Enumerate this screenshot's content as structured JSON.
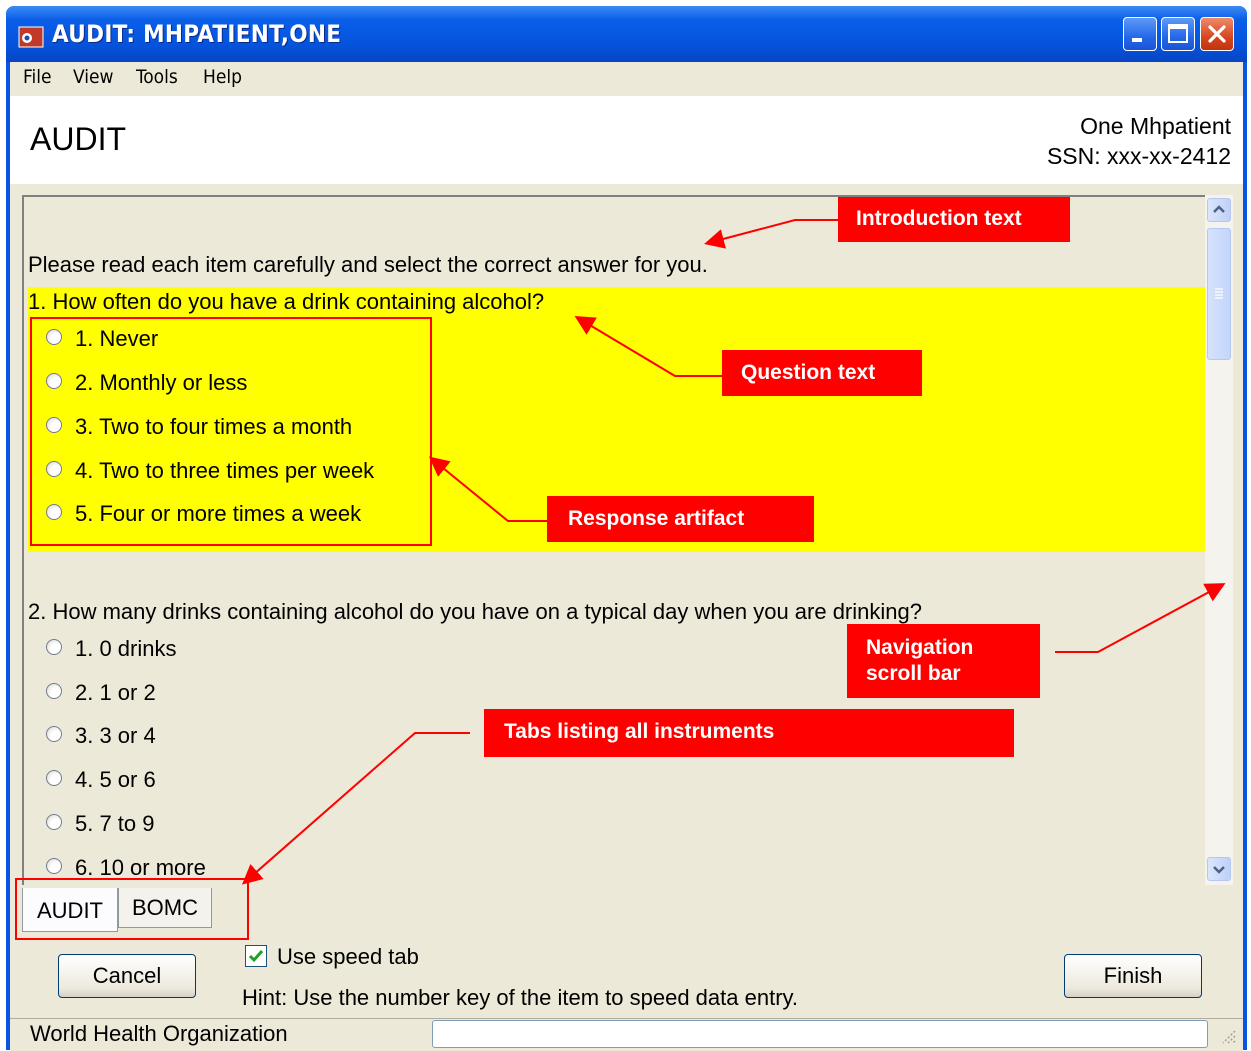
{
  "window": {
    "title": "AUDIT: MHPATIENT,ONE"
  },
  "menu": [
    "File",
    "View",
    "Tools",
    "Help"
  ],
  "header": {
    "instrument": "AUDIT",
    "patient_name": "One Mhpatient",
    "ssn": "SSN: xxx-xx-2412"
  },
  "content": {
    "intro": "Please read each item carefully and select the correct answer for you.",
    "questions": [
      {
        "text": "1. How often do you have a drink containing alcohol?",
        "options": [
          "1. Never",
          "2. Monthly or less",
          "3. Two to four times a month",
          "4. Two to three times per week",
          "5. Four or more times a week"
        ]
      },
      {
        "text": "2. How many drinks containing alcohol do you have on a typical day when you are drinking?",
        "options": [
          "1. 0 drinks",
          "2. 1 or 2",
          "3. 3 or 4",
          "4. 5 or 6",
          "5. 7 to 9",
          "6. 10 or more"
        ]
      }
    ]
  },
  "annotations": {
    "intro": "Introduction text",
    "question": "Question text",
    "response": "Response artifact",
    "scroll_line1": "Navigation",
    "scroll_line2": "scroll bar",
    "tabs": "Tabs listing all instruments"
  },
  "tabs": [
    "AUDIT",
    "BOMC"
  ],
  "footer": {
    "cancel": "Cancel",
    "finish": "Finish",
    "speed_tab": "Use speed tab",
    "speed_tab_checked": true,
    "hint": "Hint: Use the number key of the item to speed data entry.",
    "status": "World Health Organization"
  },
  "colors": {
    "highlight": "#ffff00",
    "annotation": "#ff0000",
    "titlebar": "#0a5ee8"
  }
}
